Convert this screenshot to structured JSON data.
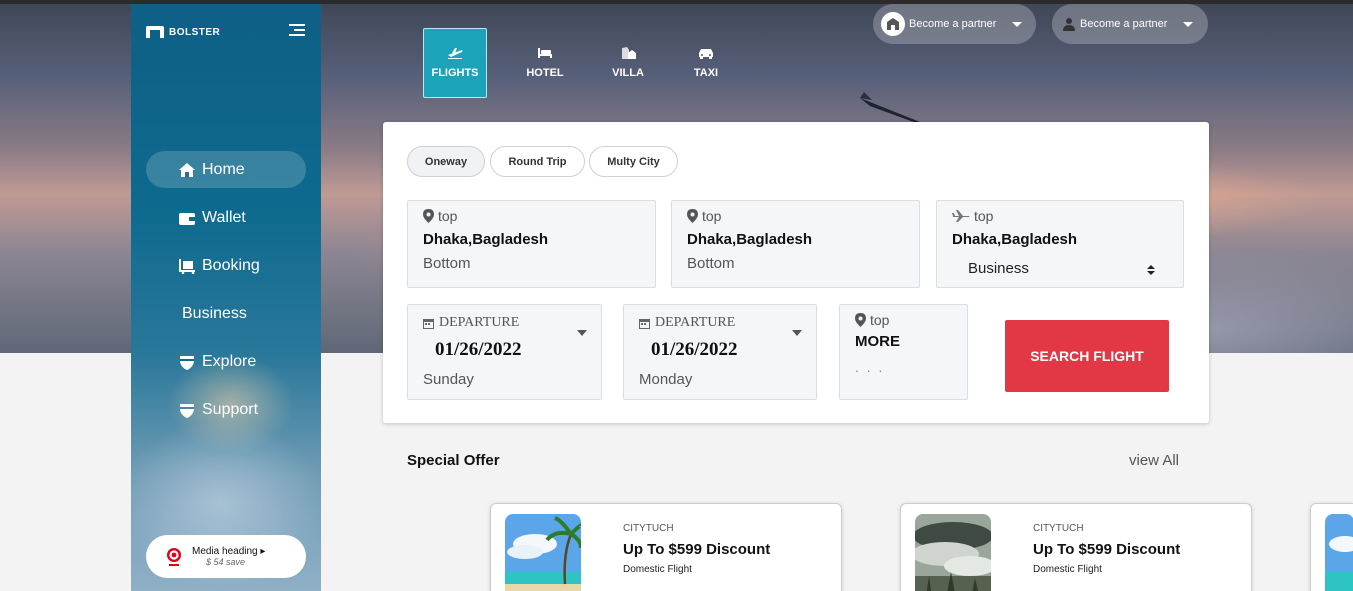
{
  "brand": {
    "name": "BOLSTER"
  },
  "sidebar": {
    "items": [
      {
        "label": "Home",
        "icon": "home-icon",
        "active": true
      },
      {
        "label": "Wallet",
        "icon": "wallet-icon"
      },
      {
        "label": "Booking",
        "icon": "luggage-icon"
      },
      {
        "label": "Business",
        "icon": ""
      },
      {
        "label": "Explore",
        "icon": "shield-icon"
      },
      {
        "label": "Support",
        "icon": "shield-icon"
      }
    ],
    "promo": {
      "title": "Media heading",
      "save": "$ 54 save",
      "logo": "target-logo"
    }
  },
  "tabs": [
    {
      "label": "FLIGHTS",
      "icon": "plane-icon",
      "active": true
    },
    {
      "label": "HOTEL",
      "icon": "bed-icon"
    },
    {
      "label": "VILLA",
      "icon": "villa-icon"
    },
    {
      "label": "TAXI",
      "icon": "taxi-icon"
    }
  ],
  "partners": [
    {
      "label": "Become a partner",
      "icon": "partner-home-icon"
    },
    {
      "label": "Become a partner",
      "icon": "user-icon"
    }
  ],
  "search": {
    "trip_types": [
      "Oneway",
      "Round Trip",
      "Multy City"
    ],
    "from": {
      "top": "top",
      "main": "Dhaka,Bagladesh",
      "sub": "Bottom"
    },
    "to": {
      "top": "top",
      "main": "Dhaka,Bagladesh",
      "sub": "Bottom"
    },
    "class": {
      "top": "top",
      "main": "Dhaka,Bagladesh",
      "selected": "Business"
    },
    "departure1": {
      "label": "DEPARTURE",
      "date": "01/26/2022",
      "day": "Sunday"
    },
    "departure2": {
      "label": "DEPARTURE",
      "date": "01/26/2022",
      "day": "Monday"
    },
    "more": {
      "top": "top",
      "main": "MORE",
      "sub": ". . ."
    },
    "button": "SEARCH FLIGHT"
  },
  "offers_section": {
    "title": "Special Offer",
    "view_all": "view All"
  },
  "offers": [
    {
      "brand": "CITYTUCH",
      "title": "Up To $599 Discount",
      "sub": "Domestic Flight",
      "image": "beach-image"
    },
    {
      "brand": "CITYTUCH",
      "title": "Up To $599 Discount",
      "sub": "Domestic Flight",
      "image": "forest-image"
    }
  ],
  "colors": {
    "sidebar": "#0d6a8e",
    "accent": "#1aa3ba",
    "search_button": "#e23744"
  }
}
